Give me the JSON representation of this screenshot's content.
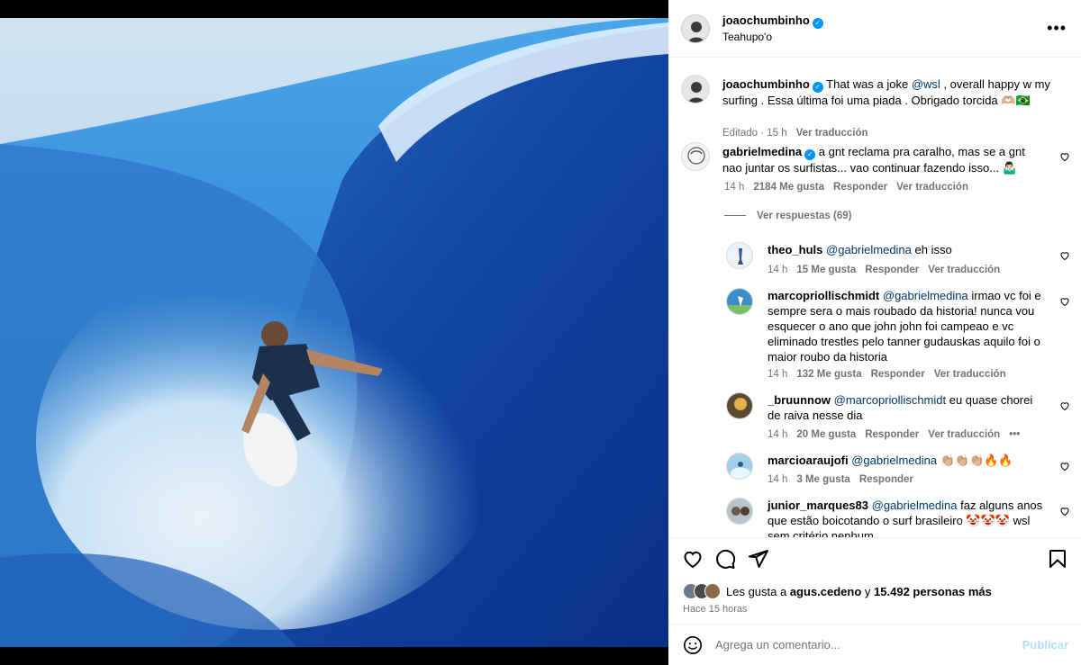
{
  "post": {
    "author": "joaochumbinho",
    "location": "Teahupo'o"
  },
  "caption": {
    "user": "joaochumbinho",
    "text_pre": "That was a joke ",
    "mention": "@wsl",
    "text_post": " , overall happy w my surfing . Essa última foi uma piada . Obrigado torcida 🫶🏼🇧🇷",
    "meta_edited": "Editado · 15 h",
    "translate": "Ver traducción"
  },
  "comments": [
    {
      "user": "gabrielmedina",
      "text": "a gnt reclama pra caralho, mas se a gnt nao juntar os surfistas... vao continuar fazendo isso... 🤷🏻‍♂️",
      "time": "14 h",
      "likes": "2184 Me gusta",
      "reply": "Responder",
      "translate": "Ver traducción"
    }
  ],
  "view_replies": "Ver respuestas (69)",
  "replies": [
    {
      "user": "theo_huls",
      "mention": "@gabrielmedina",
      "text": " eh isso",
      "time": "14 h",
      "likes": "15 Me gusta",
      "reply": "Responder",
      "translate": "Ver traducción"
    },
    {
      "user": "marcopriollischmidt",
      "mention": "@gabrielmedina",
      "text": " irmao vc foi e sempre sera o mais roubado da historia! nunca vou esquecer o ano que john john foi campeao e vc eliminado trestles pelo tanner gudauskas aquilo foi o maior roubo da historia",
      "time": "14 h",
      "likes": "132 Me gusta",
      "reply": "Responder",
      "translate": "Ver traducción"
    },
    {
      "user": "_bruunnow",
      "mention": "@marcopriollischmidt",
      "text": " eu quase chorei de raiva nesse dia",
      "time": "14 h",
      "likes": "20 Me gusta",
      "reply": "Responder",
      "translate": "Ver traducción",
      "dots": "•••"
    },
    {
      "user": "marcioaraujofi",
      "mention": "@gabrielmedina",
      "text": " 👏🏼👏🏼👏🏼🔥🔥",
      "time": "14 h",
      "likes": "3 Me gusta",
      "reply": "Responder"
    },
    {
      "user": "junior_marques83",
      "mention": "@gabrielmedina",
      "text": " faz alguns anos que estão boicotando o surf brasileiro 🤡🤡🤡 wsl sem critério nenhum"
    }
  ],
  "likes_line": {
    "prefix": "Les gusta a ",
    "user": "agus.cedeno",
    "middle": " y ",
    "others": "15.492 personas más"
  },
  "posted": "Hace 15 horas",
  "add_comment": {
    "placeholder": "Agrega un comentario...",
    "publish": "Publicar"
  },
  "colors": {
    "link": "#00376b",
    "verified": "#0095f6",
    "secondary": "#737373",
    "publish_disabled": "#b2dffc"
  },
  "icons": [
    "more-icon",
    "verified-icon",
    "heart-icon",
    "comment-icon",
    "share-icon",
    "bookmark-icon",
    "emoji-icon"
  ]
}
